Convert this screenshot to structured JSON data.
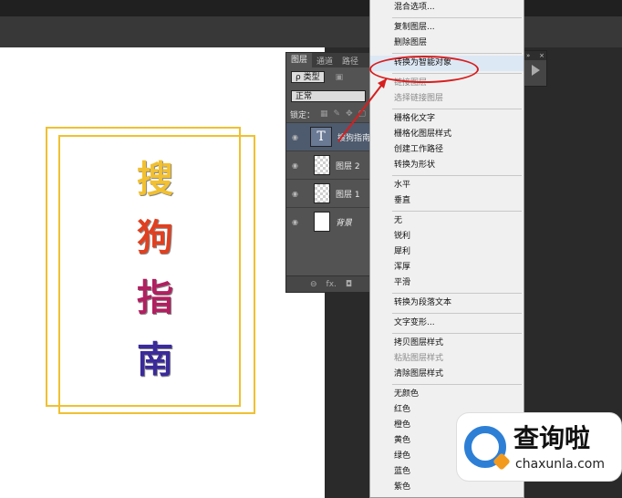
{
  "canvas_text": [
    "搜",
    "狗",
    "指",
    "南"
  ],
  "layers_panel": {
    "tabs": [
      "图层",
      "通道",
      "路径"
    ],
    "filter": "ρ 类型",
    "blend_mode": "正常",
    "lock_label": "锁定：",
    "layers": [
      {
        "name": "搜狗指南",
        "thumb": "T",
        "selected": true
      },
      {
        "name": "图层 2",
        "selected": false
      },
      {
        "name": "图层 1",
        "selected": false
      },
      {
        "name": "背景",
        "selected": false
      }
    ],
    "bottom_icons": [
      "⊖",
      "fx.",
      "◘"
    ]
  },
  "context_menu": {
    "items": [
      {
        "label": "混合选项...",
        "disabled": false
      },
      {
        "sep": true
      },
      {
        "label": "复制图层...",
        "disabled": false
      },
      {
        "label": "删除图层",
        "disabled": false
      },
      {
        "sep": true
      },
      {
        "label": "转换为智能对象",
        "disabled": false,
        "highlight": true
      },
      {
        "sep": true
      },
      {
        "label": "链接图层",
        "disabled": true
      },
      {
        "label": "选择链接图层",
        "disabled": true
      },
      {
        "sep": true
      },
      {
        "label": "栅格化文字",
        "disabled": false
      },
      {
        "label": "栅格化图层样式",
        "disabled": false
      },
      {
        "label": "创建工作路径",
        "disabled": false
      },
      {
        "label": "转换为形状",
        "disabled": false
      },
      {
        "sep": true
      },
      {
        "label": "水平",
        "disabled": false
      },
      {
        "label": "垂直",
        "disabled": false
      },
      {
        "sep": true
      },
      {
        "label": "无",
        "disabled": false
      },
      {
        "label": "锐利",
        "disabled": false
      },
      {
        "label": "犀利",
        "disabled": false
      },
      {
        "label": "浑厚",
        "disabled": false
      },
      {
        "label": "平滑",
        "disabled": false
      },
      {
        "sep": true
      },
      {
        "label": "转换为段落文本",
        "disabled": false
      },
      {
        "sep": true
      },
      {
        "label": "文字变形...",
        "disabled": false
      },
      {
        "sep": true
      },
      {
        "label": "拷贝图层样式",
        "disabled": false
      },
      {
        "label": "粘贴图层样式",
        "disabled": true
      },
      {
        "label": "清除图层样式",
        "disabled": false
      },
      {
        "sep": true
      },
      {
        "label": "无颜色",
        "disabled": false
      },
      {
        "label": "红色",
        "disabled": false
      },
      {
        "label": "橙色",
        "disabled": false
      },
      {
        "label": "黄色",
        "disabled": false
      },
      {
        "label": "绿色",
        "disabled": false
      },
      {
        "label": "蓝色",
        "disabled": false
      },
      {
        "label": "紫色",
        "disabled": false
      }
    ]
  },
  "watermark": {
    "cn": "查询啦",
    "en": "chaxunla.com"
  },
  "colors": {
    "highlight_circle": "#d81e1e",
    "frame": "#f0c030"
  }
}
